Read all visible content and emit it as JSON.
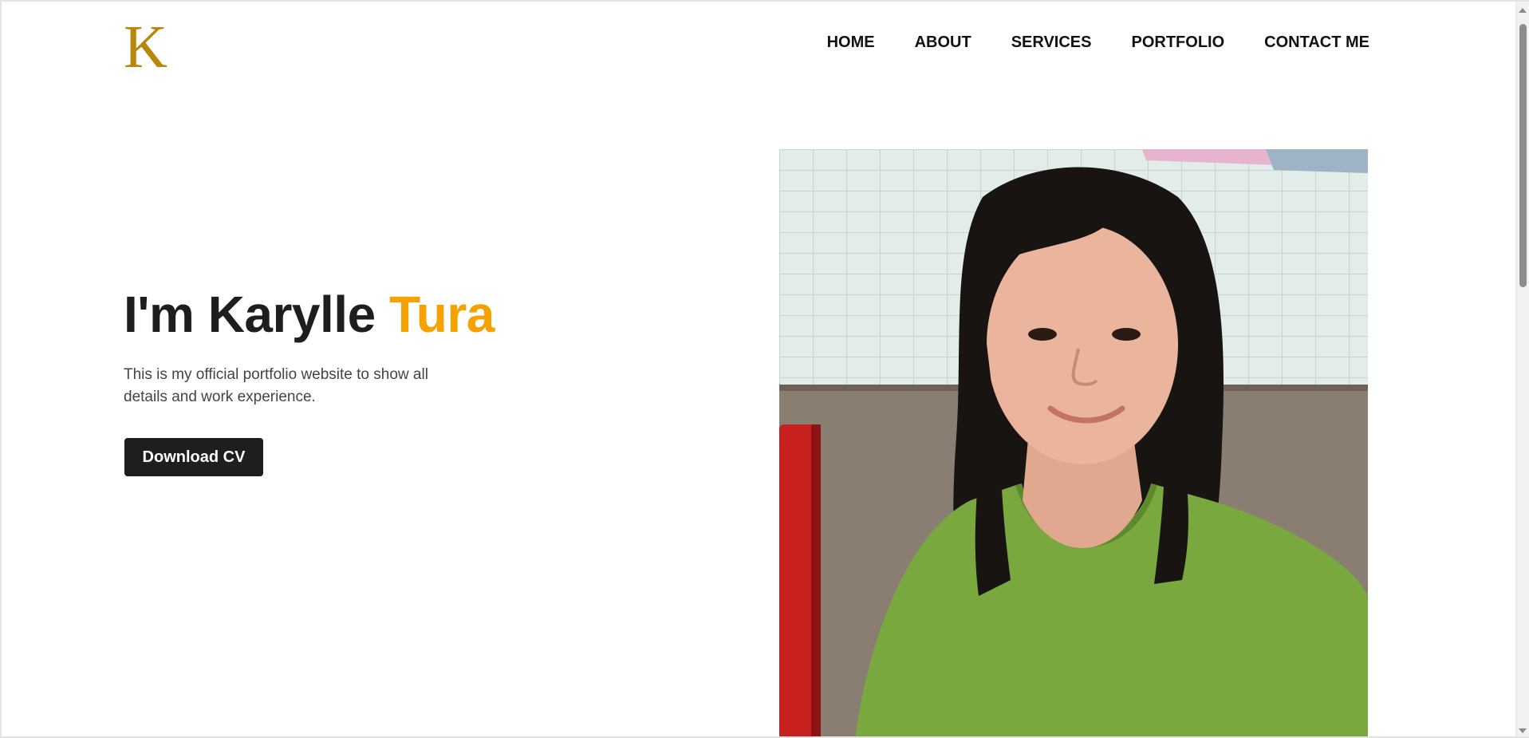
{
  "header": {
    "logo_letter": "K",
    "nav": [
      {
        "label": "HOME"
      },
      {
        "label": "ABOUT"
      },
      {
        "label": "SERVICES"
      },
      {
        "label": "PORTFOLIO"
      },
      {
        "label": "CONTACT ME"
      }
    ]
  },
  "hero": {
    "title_prefix": "I'm Karylle ",
    "title_accent": "Tura",
    "description": "This is my official portfolio website to show all details and work experience.",
    "cta_label": "Download CV"
  },
  "colors": {
    "accent": "#f5a100",
    "logo": "#b8860b",
    "button_bg": "#1e1e1e",
    "text_dark": "#1e1e1e"
  }
}
